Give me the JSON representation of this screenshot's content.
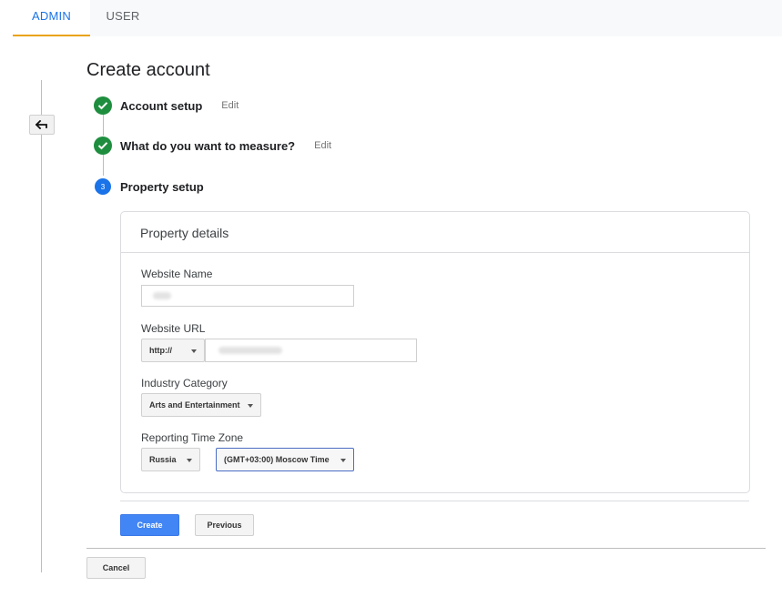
{
  "tabs": [
    {
      "label": "ADMIN",
      "active": true
    },
    {
      "label": "USER",
      "active": false
    }
  ],
  "page": {
    "title": "Create account",
    "back_icon": "arrow-back-icon"
  },
  "steps": [
    {
      "label": "Account setup",
      "edit": "Edit",
      "status": "done"
    },
    {
      "label": "What do you want to measure?",
      "edit": "Edit",
      "status": "done"
    },
    {
      "label": "Property setup",
      "number": "3",
      "status": "active"
    }
  ],
  "property": {
    "title": "Property details",
    "website_name": {
      "label": "Website Name",
      "value": ""
    },
    "website_url": {
      "label": "Website URL",
      "protocol": "http://",
      "value": ""
    },
    "industry": {
      "label": "Industry Category",
      "selected": "Arts and Entertainment"
    },
    "timezone": {
      "label": "Reporting Time Zone",
      "country": "Russia",
      "zone": "(GMT+03:00) Moscow Time"
    }
  },
  "buttons": {
    "create": "Create",
    "previous": "Previous",
    "cancel": "Cancel"
  },
  "colors": {
    "accent": "#1a73e8",
    "tab_underline": "#e8a317",
    "done": "#1e8e3e",
    "primary_button": "#4285f4"
  }
}
